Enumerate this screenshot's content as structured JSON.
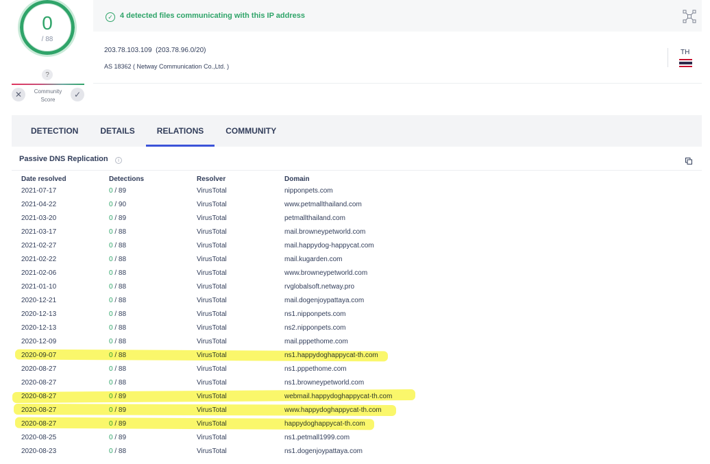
{
  "score": {
    "detections": "0",
    "total": "/ 88",
    "community_unknown": "?",
    "community_label_1": "Community",
    "community_label_2": "Score",
    "vote_down": "✕",
    "vote_up": "✓"
  },
  "banner": {
    "icon": "✓",
    "text": "4 detected files communicating with this IP address"
  },
  "ip": {
    "address": "203.78.103.109",
    "range": "(203.78.96.0/20)",
    "as_line": "AS 18362 ( Netway Communication Co.,Ltd. )",
    "country": "TH"
  },
  "tabs": [
    "DETECTION",
    "DETAILS",
    "RELATIONS",
    "COMMUNITY"
  ],
  "section": {
    "title": "Passive DNS Replication",
    "info": "i"
  },
  "table": {
    "headers": [
      "Date resolved",
      "Detections",
      "Resolver",
      "Domain"
    ],
    "rows": [
      {
        "date": "2021-07-17",
        "det": "0",
        "total": " / 89",
        "resolver": "VirusTotal",
        "domain": "nipponpets.com"
      },
      {
        "date": "2021-04-22",
        "det": "0",
        "total": " / 90",
        "resolver": "VirusTotal",
        "domain": "www.petmallthailand.com"
      },
      {
        "date": "2021-03-20",
        "det": "0",
        "total": " / 89",
        "resolver": "VirusTotal",
        "domain": "petmallthailand.com"
      },
      {
        "date": "2021-03-17",
        "det": "0",
        "total": " / 88",
        "resolver": "VirusTotal",
        "domain": "mail.browneypetworld.com"
      },
      {
        "date": "2021-02-27",
        "det": "0",
        "total": " / 88",
        "resolver": "VirusTotal",
        "domain": "mail.happydog-happycat.com"
      },
      {
        "date": "2021-02-22",
        "det": "0",
        "total": " / 88",
        "resolver": "VirusTotal",
        "domain": "mail.kugarden.com"
      },
      {
        "date": "2021-02-06",
        "det": "0",
        "total": " / 88",
        "resolver": "VirusTotal",
        "domain": "www.browneypetworld.com"
      },
      {
        "date": "2021-01-10",
        "det": "0",
        "total": " / 88",
        "resolver": "VirusTotal",
        "domain": "rvglobalsoft.netway.pro"
      },
      {
        "date": "2020-12-21",
        "det": "0",
        "total": " / 88",
        "resolver": "VirusTotal",
        "domain": "mail.dogenjoypattaya.com"
      },
      {
        "date": "2020-12-13",
        "det": "0",
        "total": " / 88",
        "resolver": "VirusTotal",
        "domain": "ns1.nipponpets.com"
      },
      {
        "date": "2020-12-13",
        "det": "0",
        "total": " / 88",
        "resolver": "VirusTotal",
        "domain": "ns2.nipponpets.com"
      },
      {
        "date": "2020-12-09",
        "det": "0",
        "total": " / 88",
        "resolver": "VirusTotal",
        "domain": "mail.pppethome.com"
      },
      {
        "date": "2020-09-07",
        "det": "0",
        "total": " / 88",
        "resolver": "VirusTotal",
        "domain": "ns1.happydoghappycat-th.com"
      },
      {
        "date": "2020-08-27",
        "det": "0",
        "total": " / 88",
        "resolver": "VirusTotal",
        "domain": "ns1.pppethome.com"
      },
      {
        "date": "2020-08-27",
        "det": "0",
        "total": " / 88",
        "resolver": "VirusTotal",
        "domain": "ns1.browneypetworld.com"
      },
      {
        "date": "2020-08-27",
        "det": "0",
        "total": " / 89",
        "resolver": "VirusTotal",
        "domain": "webmail.happydoghappycat-th.com"
      },
      {
        "date": "2020-08-27",
        "det": "0",
        "total": " / 89",
        "resolver": "VirusTotal",
        "domain": "www.happydoghappycat-th.com"
      },
      {
        "date": "2020-08-27",
        "det": "0",
        "total": " / 89",
        "resolver": "VirusTotal",
        "domain": "happydoghappycat-th.com"
      },
      {
        "date": "2020-08-25",
        "det": "0",
        "total": " / 89",
        "resolver": "VirusTotal",
        "domain": "ns1.petmall1999.com"
      },
      {
        "date": "2020-08-23",
        "det": "0",
        "total": " / 88",
        "resolver": "VirusTotal",
        "domain": "ns1.dogenjoypattaya.com"
      }
    ]
  },
  "colors": {
    "accent_green": "#2fa469",
    "tab_underline": "#3b53d8",
    "highlighter": "#f9f54a"
  },
  "icons": [
    "info-circle-icon",
    "graph-view-icon",
    "thailand-flag-icon",
    "copy-icon",
    "close-icon",
    "check-icon"
  ]
}
